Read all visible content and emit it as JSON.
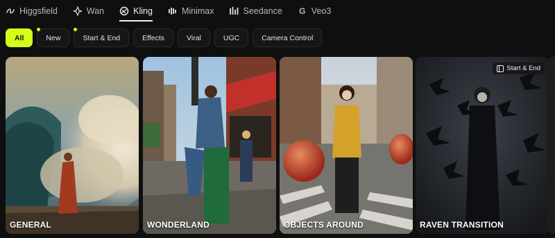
{
  "model_tabs": [
    {
      "label": "Higgsfield",
      "icon": "higgsfield-icon"
    },
    {
      "label": "Wan",
      "icon": "wan-icon"
    },
    {
      "label": "Kling",
      "icon": "kling-icon",
      "active": true
    },
    {
      "label": "Minimax",
      "icon": "minimax-icon"
    },
    {
      "label": "Seedance",
      "icon": "seedance-icon"
    },
    {
      "label": "Veo3",
      "icon": "veo3-icon"
    }
  ],
  "filters": [
    {
      "label": "All",
      "active": true
    },
    {
      "label": "New",
      "dot": true
    },
    {
      "label": "Start & End",
      "dot": true
    },
    {
      "label": "Effects"
    },
    {
      "label": "Viral"
    },
    {
      "label": "UGC"
    },
    {
      "label": "Camera Control"
    }
  ],
  "cards": [
    {
      "title": "GENERAL"
    },
    {
      "title": "WONDERLAND"
    },
    {
      "title": "OBJECTS AROUND"
    },
    {
      "title": "RAVEN TRANSITION",
      "badge": "Start & End"
    }
  ],
  "colors": {
    "accent": "#d4ff1a",
    "background": "#0f0f10"
  }
}
